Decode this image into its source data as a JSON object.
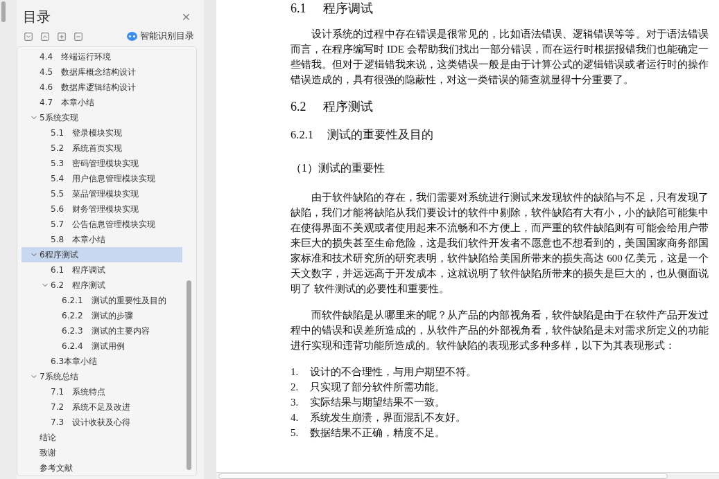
{
  "sidebar": {
    "title": "目录",
    "smart_button": "智能识别目录",
    "items": [
      {
        "children": [
          {
            "number": "4.4",
            "title": "终端运行环境",
            "selected": false
          },
          {
            "number": "4.5",
            "title": "数据库概念结构设计",
            "selected": false
          },
          {
            "number": "4.6",
            "title": "数据库逻辑结构设计",
            "selected": false
          },
          {
            "number": "4.7",
            "title": "本章小结",
            "selected": false
          }
        ]
      },
      {
        "label": "5系统实现",
        "expanded": true,
        "selected": false,
        "children": [
          {
            "number": "5.1",
            "title": "登录模块实现",
            "selected": false
          },
          {
            "number": "5.2",
            "title": "系统首页实现",
            "selected": false
          },
          {
            "number": "5.3",
            "title": "密码管理模块实现",
            "selected": false
          },
          {
            "number": "5.4",
            "title": "用户信息管理模块实现",
            "selected": false
          },
          {
            "number": "5.5",
            "title": "菜品管理模块实现",
            "selected": false
          },
          {
            "number": "5.6",
            "title": "财务管理模块实现",
            "selected": false
          },
          {
            "number": "5.7",
            "title": "公告信息管理模块实现",
            "selected": false
          },
          {
            "number": "5.8",
            "title": "本章小结",
            "selected": false
          }
        ]
      },
      {
        "label": "6程序测试",
        "expanded": true,
        "selected": true,
        "children": [
          {
            "number": "6.1",
            "title": "程序调试",
            "selected": false
          },
          {
            "number": "6.2",
            "title": "程序测试",
            "expanded": true,
            "selected": false,
            "children": [
              {
                "number": "6.2.1",
                "title": "测试的重要性及目的",
                "selected": false
              },
              {
                "number": "6.2.2",
                "title": "测试的步骤",
                "selected": false
              },
              {
                "number": "6.2.3",
                "title": "测试的主要内容",
                "selected": false
              },
              {
                "number": "6.2.4",
                "title": "测试用例",
                "selected": false
              }
            ]
          },
          {
            "label": "6.3本章小结",
            "selected": false
          }
        ]
      },
      {
        "label": "7系统总结",
        "expanded": true,
        "selected": false,
        "children": [
          {
            "number": "7.1",
            "title": "系统特点",
            "selected": false
          },
          {
            "number": "7.2",
            "title": "系统不足及改进",
            "selected": false
          },
          {
            "number": "7.3",
            "title": "设计收获及心得",
            "selected": false
          }
        ]
      },
      {
        "label": "结论",
        "selected": false
      },
      {
        "label": "致谢",
        "selected": false
      },
      {
        "label": "参考文献",
        "selected": false
      }
    ]
  },
  "document": {
    "blocks": [
      {
        "kind": "h2",
        "number": "6.1",
        "title": "程序调试"
      },
      {
        "kind": "paragraph",
        "text": "设计系统的过程中存在错误是很常见的，比如语法错误、逻辑错误等等。对于语法错误而言，在程序编写时 IDE 会帮助我们找出一部分错误，而在运行时根据报错我们也能确定一些错我。但对于逻辑错我来说，这类错误一般是由于计算公式的逻辑错误或者运行时的操作错误造成的，具有很强的隐蔽性，对这一类错误的筛查就显得十分重要了。"
      },
      {
        "kind": "h2",
        "number": "6.2",
        "title": "程序测试"
      },
      {
        "kind": "h3",
        "number": "6.2.1",
        "title": "测试的重要性及目的"
      },
      {
        "kind": "h4",
        "text": "（1）测试的重要性"
      },
      {
        "kind": "paragraph",
        "text": "由于软件缺陷的存在，我们需要对系统进行测试来发现软件的缺陷与不足，只有发现了缺陷，我们才能将缺陷从我们要设计的软件中剔除，软件缺陷有大有小，小的缺陷可能集中在使得界面不美观或者使用起来不流畅和不方便上，而严重的软件缺陷则有可能会给用户带来巨大的损失甚至生命危险，这是我们软件开发者不愿意也不想看到的，美国国家商务部国家标准和技术研究所的研究表明，软件缺陷给美国所带来的损失高达 600 亿美元，这是一个天文数字，并远远高于开发成本，这就说明了软件缺陷所带来的损失是巨大的，也从侧面说明了 软件测试的必要性和重要性。"
      },
      {
        "kind": "paragraph",
        "text": "而软件缺陷是从哪里来的呢？从产品的内部视角看，软件缺陷是由于在软件产品开发过程中的错误和误差所造成的，从软件产品的外部视角看，软件缺陷是未对需求所定义的功能进行实现和违背功能所造成的。软件缺陷的表现形式多种多样，以下为其表现形式："
      },
      {
        "kind": "list_item",
        "number": "1.",
        "text": "设计的不合理性，与用户期望不符。"
      },
      {
        "kind": "list_item",
        "number": "2.",
        "text": "只实现了部分软件所需功能。"
      },
      {
        "kind": "list_item",
        "number": "3.",
        "text": "实际结果与期望结果不一致。"
      },
      {
        "kind": "list_item",
        "number": "4.",
        "text": "系统发生崩溃，界面混乱不友好。"
      },
      {
        "kind": "list_item",
        "number": "5.",
        "text": "数据结果不正确，精度不足。"
      }
    ]
  }
}
